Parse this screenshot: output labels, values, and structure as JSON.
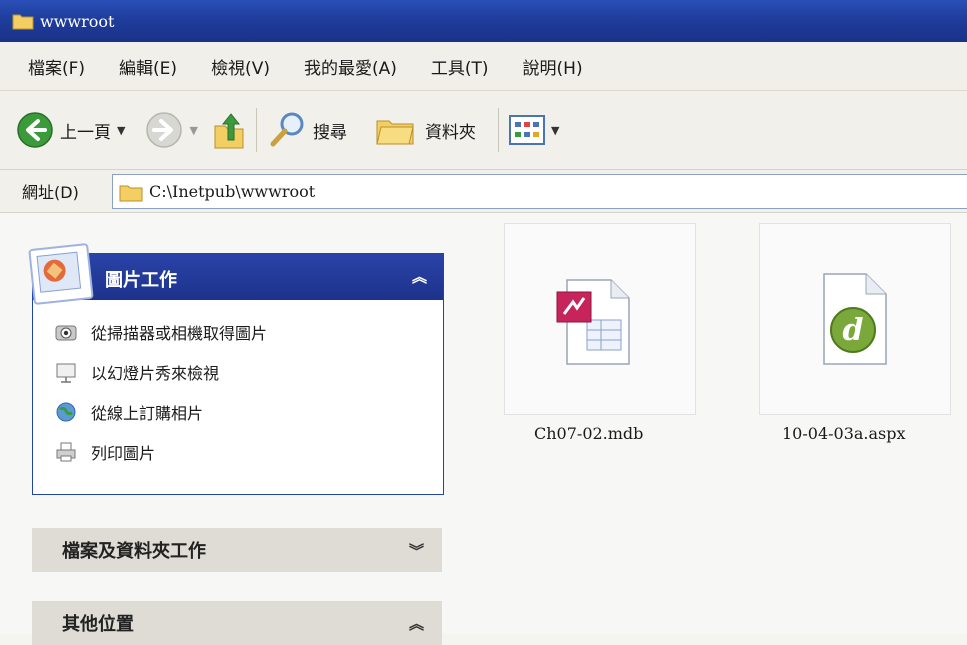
{
  "window": {
    "title": "wwwroot"
  },
  "menubar": {
    "items": [
      "檔案(F)",
      "編輯(E)",
      "檢視(V)",
      "我的最愛(A)",
      "工具(T)",
      "說明(H)"
    ]
  },
  "toolbar": {
    "back_label": "上一頁",
    "search_label": "搜尋",
    "folders_label": "資料夾"
  },
  "address": {
    "label": "網址(D)",
    "path": "C:\\Inetpub\\wwwroot"
  },
  "picture_tasks": {
    "title": "圖片工作",
    "items": [
      "從掃描器或相機取得圖片",
      "以幻燈片秀來檢視",
      "從線上訂購相片",
      "列印圖片"
    ]
  },
  "file_folder_tasks": {
    "title": "檔案及資料夾工作"
  },
  "other_places": {
    "title": "其他位置"
  },
  "files": [
    {
      "name": "Ch07-02.mdb",
      "icon": "access-database-icon"
    },
    {
      "name": "10-04-03a.aspx",
      "icon": "aspx-file-icon"
    }
  ],
  "colors": {
    "titlebar": "#1f3d9c",
    "panel_header": "#2a43a8",
    "panel_gray": "#dedcd5"
  }
}
